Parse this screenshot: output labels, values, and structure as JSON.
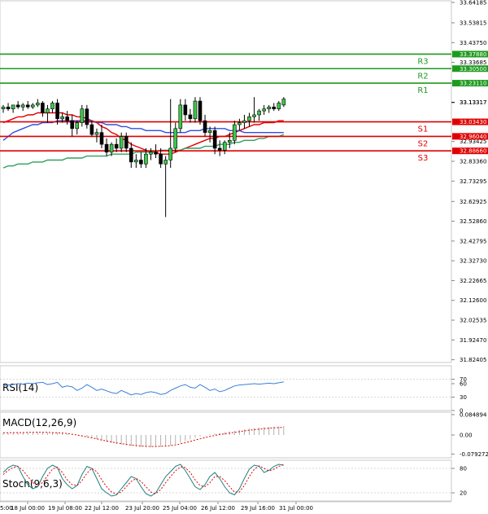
{
  "chart_data": {
    "type": "candlestick",
    "price_axis": {
      "ticks": [
        "33.64185",
        "33.53815",
        "33.43750",
        "33.33685",
        "33.23110",
        "33.13317",
        "32.93425",
        "32.83360",
        "32.73295",
        "32.62925",
        "32.52860",
        "32.42795",
        "32.32730",
        "32.22665",
        "32.12600",
        "32.02535",
        "31.92470",
        "31.82405"
      ],
      "ylim": [
        31.81,
        33.65
      ]
    },
    "time_axis": {
      "labels": [
        "18 Jul 00:00",
        "19 Jul 08:00",
        "22 Jul 12:00",
        "23 Jul 20:00",
        "25 Jul 04:00",
        "26 Jul 12:00",
        "29 Jul 16:00",
        "31 Jul 00:00"
      ],
      "first_label_fragment": "5:00"
    },
    "levels": [
      {
        "name": "R3",
        "value": 33.3788,
        "label": "33.37880",
        "kind": "resistance"
      },
      {
        "name": "R2",
        "value": 33.305,
        "label": "33.30500",
        "kind": "resistance"
      },
      {
        "name": "R1",
        "value": 33.2311,
        "label": "33.23110",
        "kind": "resistance"
      },
      {
        "name": "S1",
        "value": 33.0343,
        "label": "33.03430",
        "kind": "support"
      },
      {
        "name": "S2",
        "value": 32.9604,
        "label": "32.96040",
        "kind": "support"
      },
      {
        "name": "S3",
        "value": 32.8866,
        "label": "32.88660",
        "kind": "support"
      }
    ],
    "current_price": {
      "value": 33.13317,
      "label": "33.13317"
    },
    "candles": [
      [
        33.1,
        33.12,
        33.08,
        33.11
      ],
      [
        33.11,
        33.13,
        33.09,
        33.1
      ],
      [
        33.1,
        33.12,
        33.08,
        33.12
      ],
      [
        33.12,
        33.14,
        33.1,
        33.11
      ],
      [
        33.11,
        33.13,
        33.09,
        33.12
      ],
      [
        33.12,
        33.14,
        33.1,
        33.11
      ],
      [
        33.11,
        33.13,
        33.1,
        33.12
      ],
      [
        33.12,
        33.15,
        33.11,
        33.13
      ],
      [
        33.13,
        33.14,
        33.06,
        33.08
      ],
      [
        33.08,
        33.12,
        33.03,
        33.1
      ],
      [
        33.1,
        33.14,
        33.08,
        33.13
      ],
      [
        33.13,
        33.15,
        33.02,
        33.05
      ],
      [
        33.05,
        33.08,
        33.03,
        33.06
      ],
      [
        33.06,
        33.09,
        33.02,
        33.04
      ],
      [
        33.04,
        33.07,
        32.96,
        33.0
      ],
      [
        33.0,
        33.04,
        32.97,
        33.03
      ],
      [
        33.03,
        33.12,
        33.01,
        33.1
      ],
      [
        33.1,
        33.12,
        33.0,
        33.02
      ],
      [
        33.02,
        33.04,
        32.96,
        32.97
      ],
      [
        32.97,
        33.0,
        32.93,
        32.98
      ],
      [
        32.98,
        33.02,
        32.9,
        32.92
      ],
      [
        32.92,
        32.95,
        32.86,
        32.88
      ],
      [
        32.88,
        32.93,
        32.86,
        32.92
      ],
      [
        32.92,
        32.95,
        32.88,
        32.9
      ],
      [
        32.9,
        32.98,
        32.88,
        32.96
      ],
      [
        32.96,
        32.98,
        32.88,
        32.9
      ],
      [
        32.9,
        32.93,
        32.8,
        32.83
      ],
      [
        32.83,
        32.87,
        32.8,
        32.84
      ],
      [
        32.84,
        32.88,
        32.8,
        32.82
      ],
      [
        32.82,
        32.9,
        32.8,
        32.87
      ],
      [
        32.87,
        32.9,
        32.84,
        32.88
      ],
      [
        32.88,
        32.92,
        32.85,
        32.87
      ],
      [
        32.87,
        32.9,
        32.8,
        32.82
      ],
      [
        32.82,
        32.86,
        32.55,
        32.84
      ],
      [
        32.84,
        33.15,
        32.8,
        32.9
      ],
      [
        32.9,
        33.03,
        32.88,
        33.0
      ],
      [
        33.0,
        33.15,
        32.98,
        33.12
      ],
      [
        33.12,
        33.15,
        33.04,
        33.07
      ],
      [
        33.07,
        33.1,
        33.03,
        33.05
      ],
      [
        33.05,
        33.16,
        33.03,
        33.14
      ],
      [
        33.14,
        33.16,
        33.02,
        33.04
      ],
      [
        33.04,
        33.07,
        32.96,
        32.98
      ],
      [
        32.98,
        33.01,
        32.93,
        32.99
      ],
      [
        32.99,
        33.01,
        32.87,
        32.9
      ],
      [
        32.9,
        32.94,
        32.86,
        32.89
      ],
      [
        32.89,
        32.94,
        32.87,
        32.93
      ],
      [
        32.93,
        32.98,
        32.9,
        32.94
      ],
      [
        32.94,
        33.04,
        32.92,
        33.02
      ],
      [
        33.02,
        33.05,
        32.99,
        33.03
      ],
      [
        33.03,
        33.07,
        33.0,
        33.04
      ],
      [
        33.04,
        33.08,
        33.01,
        33.06
      ],
      [
        33.06,
        33.16,
        33.03,
        33.07
      ],
      [
        33.07,
        33.1,
        33.04,
        33.09
      ],
      [
        33.09,
        33.12,
        33.07,
        33.1
      ],
      [
        33.1,
        33.12,
        33.08,
        33.11
      ],
      [
        33.11,
        33.13,
        33.09,
        33.1
      ],
      [
        33.1,
        33.14,
        33.09,
        33.13
      ],
      [
        33.12,
        33.16,
        33.11,
        33.15
      ]
    ],
    "moving_averages": [
      {
        "color": "#e00000",
        "values": [
          33.03,
          33.04,
          33.05,
          33.06,
          33.06,
          33.07,
          33.07,
          33.08,
          33.08,
          33.08,
          33.08,
          33.08,
          33.08,
          33.07,
          33.07,
          33.06,
          33.06,
          33.05,
          33.04,
          33.03,
          33.01,
          33.0,
          32.98,
          32.97,
          32.95,
          32.94,
          32.92,
          32.91,
          32.9,
          32.89,
          32.88,
          32.88,
          32.87,
          32.87,
          32.87,
          32.88,
          32.89,
          32.9,
          32.91,
          32.92,
          32.93,
          32.94,
          32.95,
          32.95,
          32.96,
          32.96,
          32.97,
          32.98,
          32.99,
          33.0,
          33.01,
          33.02,
          33.02,
          33.03,
          33.03,
          33.03,
          33.04,
          33.04
        ]
      },
      {
        "color": "#3050e0",
        "values": [
          32.94,
          32.96,
          32.98,
          32.99,
          33.0,
          33.01,
          33.02,
          33.02,
          33.03,
          33.03,
          33.03,
          33.04,
          33.04,
          33.04,
          33.04,
          33.04,
          33.04,
          33.04,
          33.04,
          33.03,
          33.03,
          33.02,
          33.02,
          33.02,
          33.01,
          33.01,
          33.0,
          33.0,
          33.0,
          32.99,
          32.99,
          32.99,
          32.99,
          32.98,
          32.98,
          32.98,
          32.98,
          32.98,
          32.99,
          32.99,
          32.99,
          33.0,
          33.0,
          33.0,
          33.0,
          33.0,
          32.99,
          32.99,
          32.99,
          32.98,
          32.98,
          32.98,
          32.98,
          32.98,
          32.98,
          32.98,
          32.98,
          32.98
        ]
      },
      {
        "color": "#30a060",
        "values": [
          32.8,
          32.81,
          32.81,
          32.82,
          32.82,
          32.82,
          32.83,
          32.83,
          32.83,
          32.84,
          32.84,
          32.84,
          32.84,
          32.85,
          32.85,
          32.85,
          32.85,
          32.86,
          32.86,
          32.86,
          32.86,
          32.86,
          32.87,
          32.87,
          32.87,
          32.87,
          32.87,
          32.88,
          32.88,
          32.88,
          32.88,
          32.88,
          32.89,
          32.89,
          32.89,
          32.89,
          32.89,
          32.9,
          32.9,
          32.9,
          32.9,
          32.91,
          32.91,
          32.91,
          32.92,
          32.92,
          32.92,
          32.93,
          32.93,
          32.94,
          32.94,
          32.94,
          32.95,
          32.95,
          32.96,
          32.96,
          32.96,
          32.97
        ]
      }
    ],
    "indicators": [
      {
        "name": "RSI(14)",
        "ticks": [
          "70",
          "60",
          "30",
          "0"
        ],
        "tick_values": [
          70,
          60,
          30,
          0
        ],
        "ylim": [
          0,
          100
        ],
        "levels": [
          70,
          30
        ],
        "line_color": "#3a7fd8",
        "values": [
          55,
          57,
          58,
          60,
          59,
          61,
          60,
          62,
          63,
          58,
          60,
          63,
          52,
          55,
          53,
          45,
          50,
          58,
          52,
          45,
          48,
          44,
          40,
          38,
          45,
          40,
          35,
          38,
          36,
          40,
          42,
          40,
          36,
          38,
          45,
          50,
          55,
          58,
          52,
          50,
          58,
          52,
          45,
          48,
          42,
          45,
          50,
          55,
          57,
          58,
          59,
          60,
          59,
          60,
          61,
          60,
          62,
          64
        ]
      },
      {
        "name": "MACD(12,26,9)",
        "ticks": [
          "0.084894",
          "0.00",
          "-0.079272"
        ],
        "tick_values": [
          0.084894,
          0,
          -0.079272
        ],
        "ylim": [
          -0.095,
          0.095
        ],
        "histogram": [
          0.008,
          0.009,
          0.01,
          0.01,
          0.011,
          0.011,
          0.012,
          0.012,
          0.012,
          0.011,
          0.011,
          0.011,
          0.008,
          0.006,
          0.003,
          0.0,
          -0.004,
          -0.008,
          -0.013,
          -0.018,
          -0.023,
          -0.028,
          -0.033,
          -0.037,
          -0.04,
          -0.043,
          -0.046,
          -0.048,
          -0.05,
          -0.051,
          -0.051,
          -0.05,
          -0.049,
          -0.047,
          -0.043,
          -0.038,
          -0.032,
          -0.025,
          -0.018,
          -0.012,
          -0.006,
          -0.001,
          0.003,
          0.006,
          0.009,
          0.012,
          0.015,
          0.018,
          0.021,
          0.024,
          0.027,
          0.029,
          0.031,
          0.033,
          0.034,
          0.035,
          0.036,
          0.037
        ],
        "signal": [
          0.009,
          0.009,
          0.01,
          0.01,
          0.01,
          0.011,
          0.011,
          0.011,
          0.011,
          0.011,
          0.01,
          0.009,
          0.008,
          0.006,
          0.003,
          0.0,
          -0.004,
          -0.008,
          -0.012,
          -0.016,
          -0.021,
          -0.025,
          -0.029,
          -0.033,
          -0.036,
          -0.039,
          -0.042,
          -0.044,
          -0.046,
          -0.047,
          -0.048,
          -0.048,
          -0.047,
          -0.046,
          -0.044,
          -0.041,
          -0.037,
          -0.032,
          -0.027,
          -0.021,
          -0.016,
          -0.011,
          -0.006,
          -0.002,
          0.002,
          0.005,
          0.008,
          0.011,
          0.014,
          0.017,
          0.02,
          0.022,
          0.024,
          0.026,
          0.028,
          0.03,
          0.031,
          0.032
        ],
        "hist_color": "#b0b0b0",
        "signal_color": "#e00000"
      },
      {
        "name": "Stoch(9,6,3)",
        "ticks": [
          "80",
          "20"
        ],
        "tick_values": [
          80,
          20
        ],
        "ylim": [
          0,
          100
        ],
        "levels": [
          80,
          20
        ],
        "k_color": "#208080",
        "d_color": "#e00000",
        "k": [
          70,
          82,
          88,
          85,
          60,
          40,
          30,
          35,
          60,
          80,
          88,
          82,
          55,
          40,
          30,
          38,
          65,
          85,
          80,
          55,
          30,
          20,
          12,
          15,
          30,
          45,
          60,
          55,
          35,
          18,
          12,
          20,
          40,
          60,
          72,
          85,
          90,
          75,
          55,
          35,
          28,
          40,
          60,
          70,
          55,
          35,
          20,
          15,
          30,
          55,
          78,
          88,
          85,
          70,
          75,
          85,
          90,
          88
        ],
        "d": [
          65,
          75,
          82,
          85,
          75,
          60,
          45,
          38,
          45,
          62,
          78,
          83,
          70,
          52,
          40,
          38,
          50,
          68,
          80,
          72,
          52,
          35,
          22,
          17,
          22,
          35,
          48,
          55,
          48,
          35,
          22,
          18,
          28,
          45,
          60,
          74,
          84,
          82,
          70,
          52,
          38,
          35,
          45,
          60,
          60,
          50,
          35,
          22,
          22,
          38,
          60,
          78,
          86,
          80,
          74,
          78,
          85,
          89
        ]
      }
    ]
  }
}
